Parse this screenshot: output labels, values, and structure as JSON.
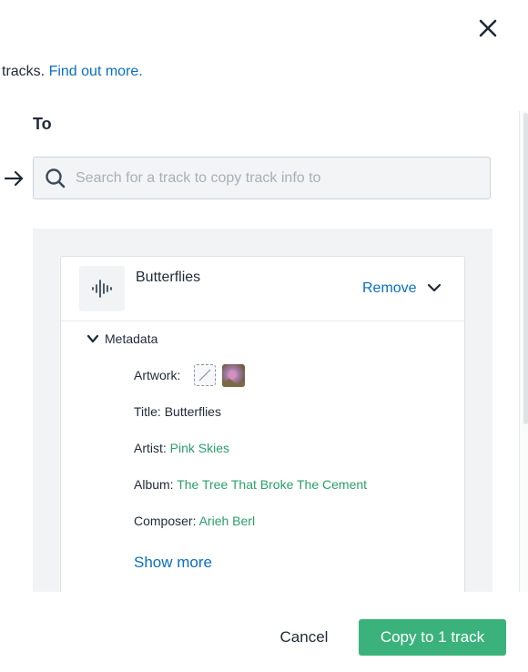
{
  "intro": {
    "text": "tracks.",
    "link": "Find out more."
  },
  "to_section": {
    "label": "To",
    "search_placeholder": "Search for a track to copy track info to"
  },
  "track": {
    "title": "Butterflies",
    "remove_label": "Remove",
    "metadata_label": "Metadata",
    "fields": {
      "artwork_label": "Artwork:",
      "title_label": "Title:",
      "title_value": "Butterflies",
      "artist_label": "Artist:",
      "artist_value": "Pink Skies",
      "album_label": "Album:",
      "album_value": "The Tree That Broke The Cement",
      "composer_label": "Composer:",
      "composer_value": "Arieh Berl"
    },
    "show_more_label": "Show more"
  },
  "footer": {
    "cancel_label": "Cancel",
    "copy_label": "Copy to 1 track"
  },
  "colors": {
    "accent_link": "#0a6fc2",
    "metadata_link": "#2aa06a",
    "primary_button": "#3bb27c"
  },
  "icons": {
    "close": "close-icon",
    "arrow": "arrow-right-icon",
    "search": "search-icon",
    "waveform": "waveform-icon",
    "chevron": "chevron-down-icon"
  }
}
